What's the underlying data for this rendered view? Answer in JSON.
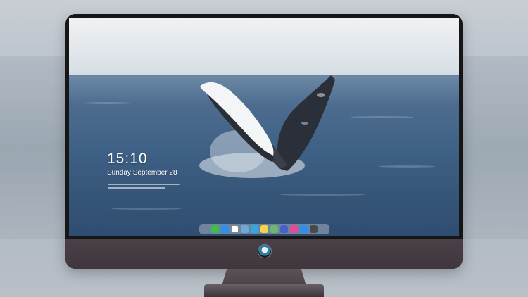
{
  "lockscreen": {
    "time": "15:10",
    "date": "Sunday September 28"
  },
  "dock": {
    "icons": [
      {
        "name": "messages-icon",
        "color": "#3dbd4b"
      },
      {
        "name": "mail-icon",
        "color": "#2f8ff0"
      },
      {
        "name": "safari-icon",
        "color": "#ffffff"
      },
      {
        "name": "photos-icon",
        "color": "#6ea7d8"
      },
      {
        "name": "files-icon",
        "color": "#2fa9e6"
      },
      {
        "name": "notes-icon",
        "color": "#f5d34a"
      },
      {
        "name": "gallery-icon",
        "color": "#6fb86a"
      },
      {
        "name": "weather-icon",
        "color": "#4b5fc9"
      },
      {
        "name": "music-icon",
        "color": "#e54a9a"
      },
      {
        "name": "appstore-icon",
        "color": "#2c8fef"
      },
      {
        "name": "camera-icon",
        "color": "#4a4a4a"
      }
    ]
  },
  "colors": {
    "bezel": "#161616",
    "chin": "#433b41",
    "accent_logo": "#2a7fa8"
  }
}
